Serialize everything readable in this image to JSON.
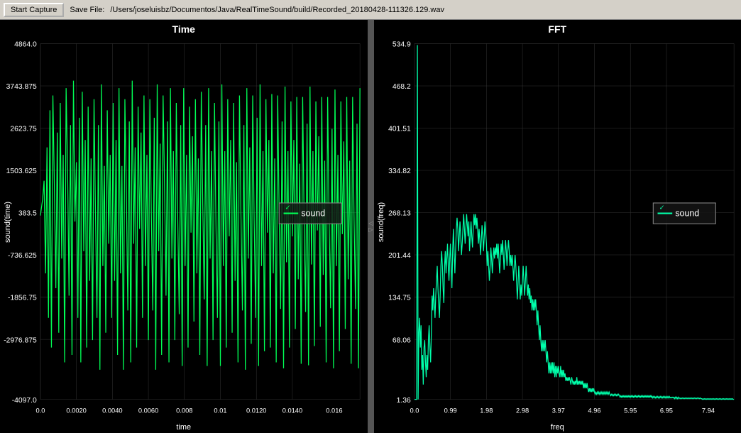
{
  "toolbar": {
    "start_capture_label": "Start Capture",
    "save_file_label": "Save File:",
    "save_file_path": "/Users/joseluisbz/Documentos/Java/RealTimeSound/build/Recorded_20180428-111326.129.wav"
  },
  "time_chart": {
    "title": "Time",
    "y_axis_label": "sound(time)",
    "x_axis_label": "time",
    "y_ticks": [
      "4864.0",
      "3743.875",
      "2623.75",
      "1503.625",
      "383.5",
      "-736.625",
      "-1856.75",
      "-2976.875",
      "-4097.0"
    ],
    "x_ticks": [
      "0.0",
      "0.0020",
      "0.0040",
      "0.0060",
      "0.008",
      "0.01",
      "0.0120",
      "0.0140",
      "0.016"
    ],
    "legend_label": "sound",
    "accent_color": "#00ff66"
  },
  "fft_chart": {
    "title": "FFT",
    "y_axis_label": "sound(freq)",
    "x_axis_label": "freq",
    "y_ticks": [
      "534.9",
      "468.2",
      "401.51",
      "334.82",
      "268.13",
      "201.44",
      "134.75",
      "68.06",
      "1.36"
    ],
    "x_ticks": [
      "0.0",
      "0.99",
      "1.98",
      "2.98",
      "3.97",
      "4.96",
      "5.95",
      "6.95",
      "7.94"
    ],
    "legend_label": "sound",
    "accent_color": "#00ffaa"
  }
}
